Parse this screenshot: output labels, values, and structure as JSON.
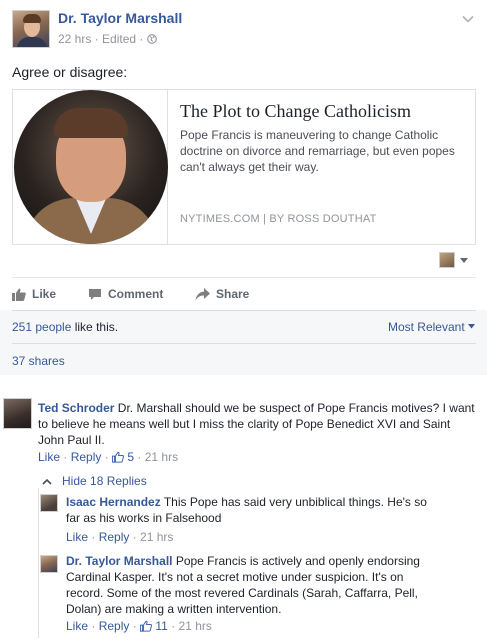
{
  "post": {
    "author": "Dr. Taylor Marshall",
    "meta": "22 hrs · Edited · ",
    "text": "Agree or disagree:",
    "icons": {
      "privacy": "globe-icon",
      "menu": "chevron-down-icon"
    }
  },
  "link_card": {
    "title": "The Plot to Change Catholicism",
    "description": "Pope Francis is maneuvering to change Catholic doctrine on divorce and remarriage, but even popes can't always get their way.",
    "source": "NYTIMES.COM  |  BY ROSS DOUTHAT"
  },
  "actions": {
    "like": "Like",
    "comment": "Comment",
    "share": "Share"
  },
  "summary": {
    "likes_count": "251 people",
    "likes_suffix": " like this.",
    "sort": "Most Relevant",
    "shares": "37 shares"
  },
  "comments": [
    {
      "author": "Ted Schroder",
      "text": " Dr. Marshall should we be suspect of Pope Francis motives? I want to believe he means well but I miss the clarity of Pope Benedict XVI and Saint John Paul II.",
      "like": "Like",
      "reply": "Reply",
      "reactions": "5",
      "time": "21 hrs"
    }
  ],
  "replies_toggle": "Hide 18 Replies",
  "replies": [
    {
      "author": "Isaac Hernandez",
      "text": " This Pope has said very unbiblical things. He's so far as his works in Falsehood",
      "like": "Like",
      "reply": "Reply",
      "time": "21 hrs"
    },
    {
      "author": "Dr. Taylor Marshall",
      "text": " Pope Francis is actively and openly endorsing Cardinal Kasper. It's not a secret motive under suspicion. It's on record. Some of the most revered Cardinals (Sarah, Caffarra, Pell, Dolan) are making a written intervention.",
      "like": "Like",
      "reply": "Reply",
      "reactions": "11",
      "time": "21 hrs"
    }
  ],
  "colors": {
    "link": "#365899",
    "muted": "#90949c",
    "text": "#1d2129",
    "like_blue": "#4267b2"
  }
}
